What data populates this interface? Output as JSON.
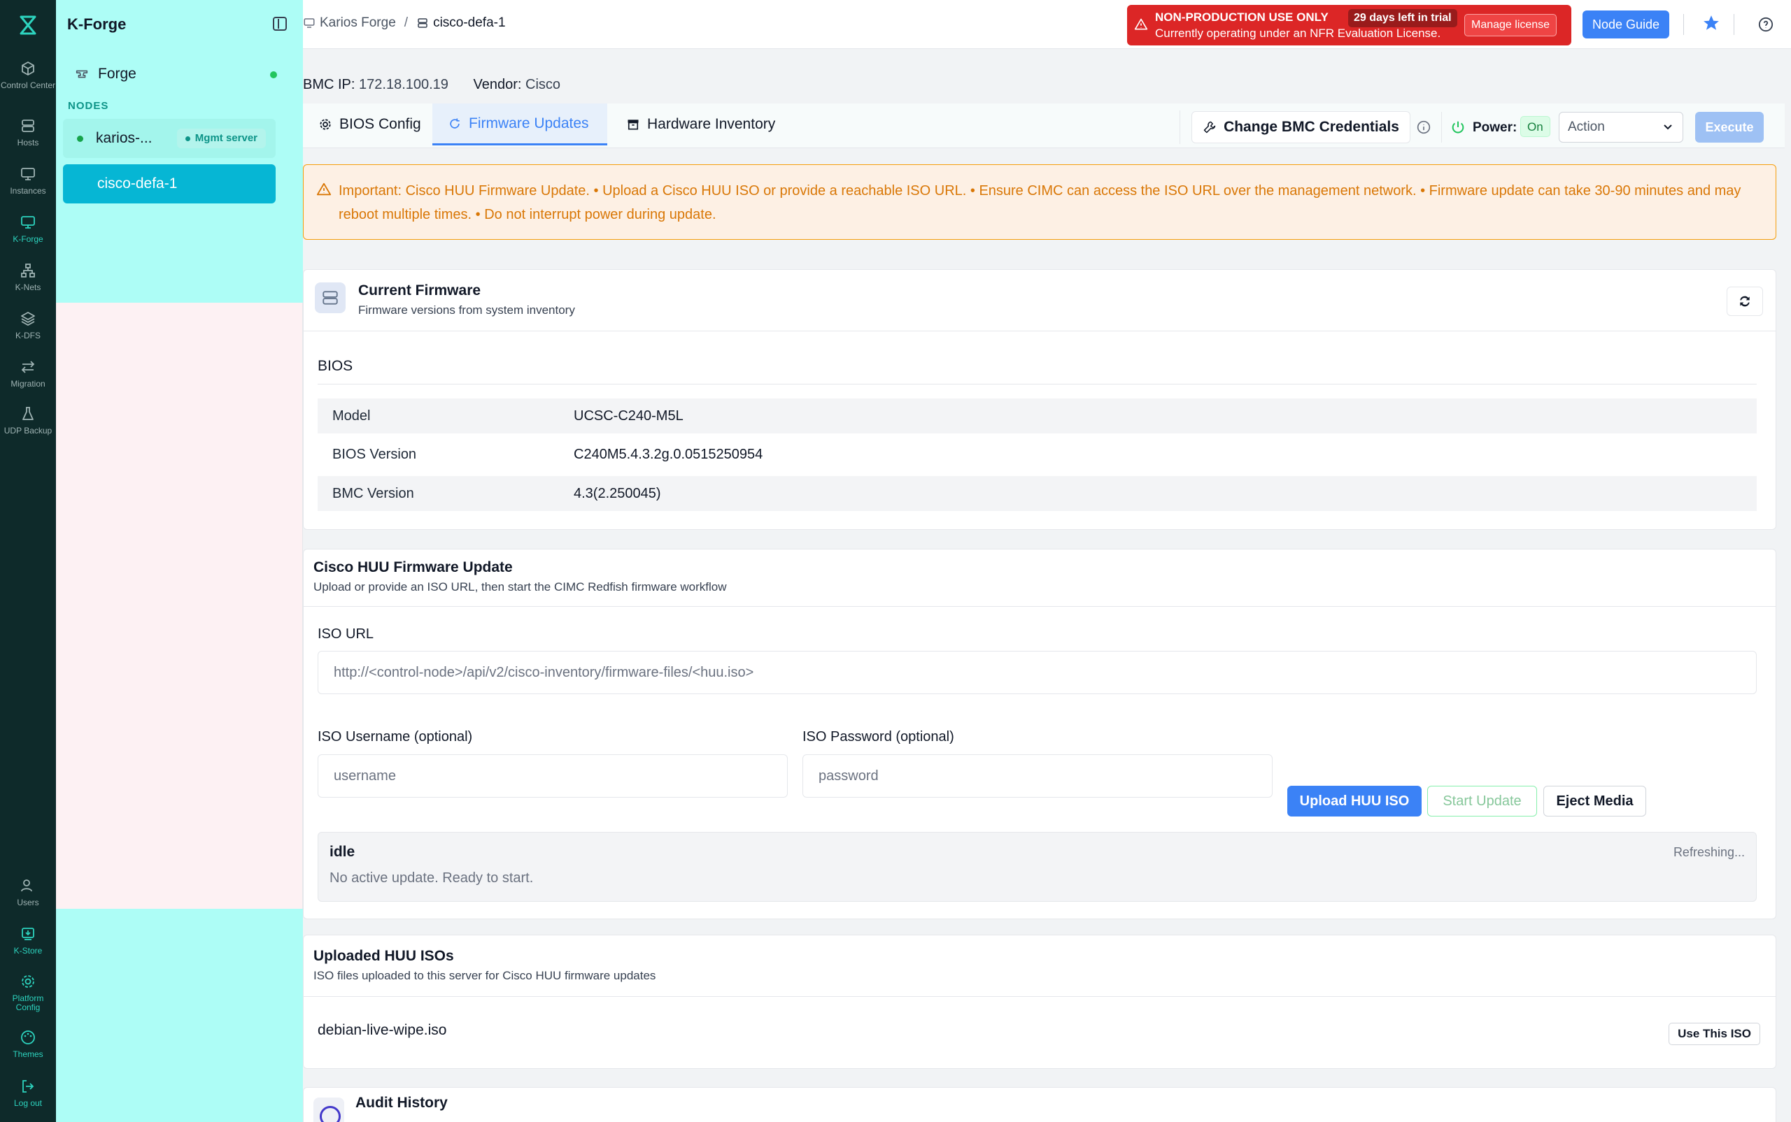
{
  "rail": {
    "items": [
      {
        "label": "Control Center",
        "icon": "cube-icon"
      },
      {
        "label": "Hosts",
        "icon": "server-icon"
      },
      {
        "label": "Instances",
        "icon": "monitor-icon"
      },
      {
        "label": "K-Forge",
        "icon": "forge-icon"
      },
      {
        "label": "K-Nets",
        "icon": "network-icon"
      },
      {
        "label": "K-DFS",
        "icon": "layers-icon"
      },
      {
        "label": "Migration",
        "icon": "arrows-icon"
      },
      {
        "label": "UDP Backup",
        "icon": "flask-icon"
      }
    ],
    "bottom": [
      {
        "label": "Users",
        "icon": "users-icon"
      },
      {
        "label": "K-Store",
        "icon": "store-icon"
      },
      {
        "label": "Platform Config",
        "icon": "gear-icon"
      },
      {
        "label": "Themes",
        "icon": "palette-icon"
      },
      {
        "label": "Log out",
        "icon": "logout-icon"
      }
    ],
    "active_color": "#2dd4bf"
  },
  "sidebar": {
    "title": "K-Forge",
    "forge_label": "Forge",
    "section_label": "NODES",
    "nodes": [
      {
        "label": "karios-...",
        "badge": "Mgmt server"
      },
      {
        "label": "cisco-defa-1"
      }
    ]
  },
  "topbar": {
    "breadcrumb_root": "Karios Forge",
    "breadcrumb_sep": "/",
    "breadcrumb_current": "cisco-defa-1",
    "trial": {
      "title": "NON-PRODUCTION USE ONLY",
      "days": "29 days left in trial",
      "subtitle": "Currently operating under an NFR Evaluation License.",
      "manage_label": "Manage license",
      "color": "#dc2626"
    },
    "node_guide_label": "Node Guide"
  },
  "bmc": {
    "ip_label": "BMC IP:",
    "ip_value": "172.18.100.19",
    "vendor_label": "Vendor:",
    "vendor_value": "Cisco"
  },
  "tabs": [
    {
      "label": "BIOS Config"
    },
    {
      "label": "Firmware Updates",
      "active": true
    },
    {
      "label": "Hardware Inventory"
    }
  ],
  "toolbar": {
    "cred_label": "Change BMC Credentials",
    "power_label": "Power:",
    "power_state": "On",
    "action_value": "Action",
    "execute_label": "Execute"
  },
  "alert": {
    "text": "Important: Cisco HUU Firmware Update. • Upload a Cisco HUU ISO or provide a reachable ISO URL. • Ensure CIMC can access the ISO URL over the management network. • Firmware update can take 30-90 minutes and may reboot multiple times. • Do not interrupt power during update."
  },
  "current_firmware": {
    "title": "Current Firmware",
    "subtitle": "Firmware versions from system inventory",
    "section": "BIOS",
    "rows": [
      {
        "key": "Model",
        "value": "UCSC-C240-M5L"
      },
      {
        "key": "BIOS Version",
        "value": "C240M5.4.3.2g.0.0515250954"
      },
      {
        "key": "BMC Version",
        "value": "4.3(2.250045)"
      }
    ]
  },
  "huu": {
    "title": "Cisco HUU Firmware Update",
    "subtitle": "Upload or provide an ISO URL, then start the CIMC Redfish firmware workflow",
    "iso_url_label": "ISO URL",
    "iso_url_placeholder": "http://<control-node>/api/v2/cisco-inventory/firmware-files/<huu.iso>",
    "username_label": "ISO Username (optional)",
    "username_placeholder": "username",
    "password_label": "ISO Password (optional)",
    "password_placeholder": "password",
    "upload_label": "Upload HUU ISO",
    "start_label": "Start Update",
    "eject_label": "Eject Media",
    "status_title": "idle",
    "status_desc": "No active update. Ready to start.",
    "status_refresh": "Refreshing..."
  },
  "uploaded": {
    "title": "Uploaded HUU ISOs",
    "subtitle": "ISO files uploaded to this server for Cisco HUU firmware updates",
    "files": [
      {
        "name": "debian-live-wipe.iso",
        "action": "Use This ISO"
      }
    ]
  },
  "audit": {
    "title": "Audit History"
  }
}
